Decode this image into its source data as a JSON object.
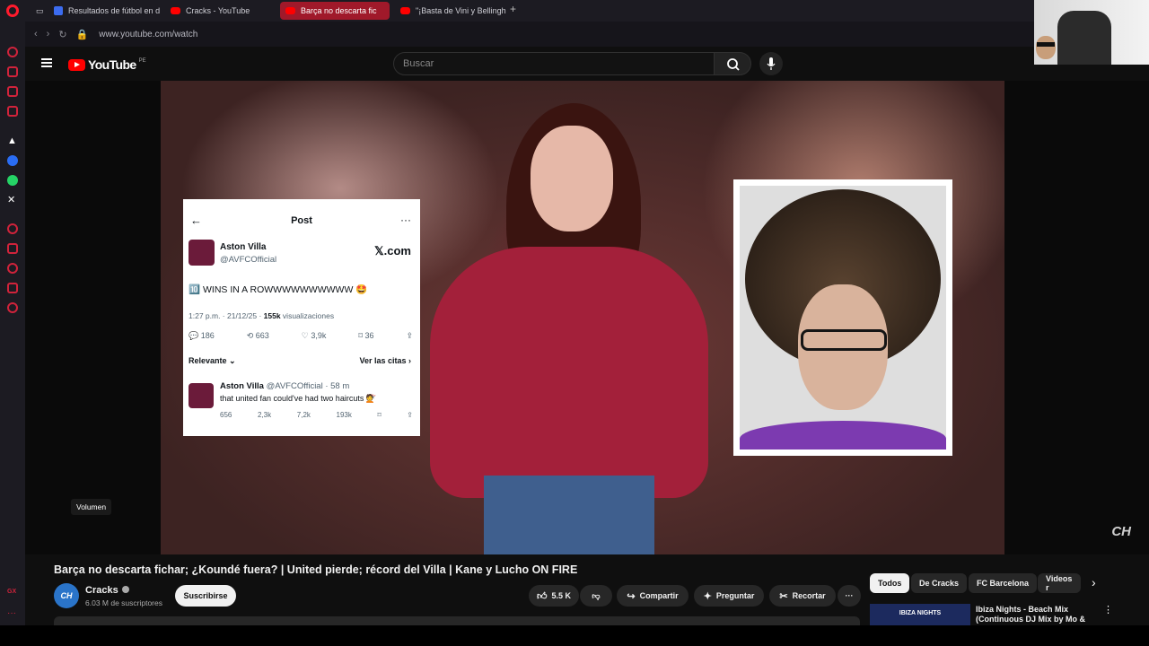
{
  "browser": {
    "tabs": [
      {
        "label": "Resultados de fútbol en d",
        "icon": "blue-square-icon"
      },
      {
        "label": "Cracks - YouTube",
        "icon": "youtube-icon"
      },
      {
        "label": "Barça no descarta fic",
        "icon": "youtube-icon",
        "active": true
      },
      {
        "label": "\"¡Basta de Vini y Bellingha",
        "icon": "youtube-icon"
      }
    ],
    "new_tab": "+",
    "url": "www.youtube.com/watch"
  },
  "youtube": {
    "logo_text": "YouTube",
    "country": "PE",
    "search_placeholder": "Buscar"
  },
  "video": {
    "tweet": {
      "header": "Post",
      "name": "Aston Villa",
      "handle": "@AVFCOfficial",
      "source": "𝕏.com",
      "text": "🔟 WINS IN A ROWWWWWWWWWW 🤩",
      "meta_time": "1:27 p.m. · 21/12/25 · ",
      "meta_views": "155k",
      "meta_views_label": " visualizaciones",
      "replies": "186",
      "reposts": "663",
      "likes": "3,9k",
      "bookmarks": "36",
      "relevant": "Relevante ⌄",
      "quotes": "Ver las citas ›",
      "reply_name": "Aston Villa",
      "reply_handle": "@AVFCOfficial · 58 m",
      "reply_text": "that united fan could've had two haircuts 💇",
      "reply_replies": "656",
      "reply_reposts": "2,3k",
      "reply_likes": "7,2k",
      "reply_views": "193k"
    },
    "volume_tooltip": "Volumen",
    "watermark": "CH"
  },
  "watch": {
    "title": "Barça no descarta fichar; ¿Koundé fuera? | United pierde; récord del Villa | Kane y Lucho ON FIRE",
    "channel_name": "Cracks",
    "channel_avatar": "CH",
    "subscribers": "6.03 M de suscriptores",
    "subscribe": "Suscribirse",
    "likes": "5.5 K",
    "share": "Compartir",
    "ask": "Preguntar",
    "clip": "Recortar"
  },
  "recommendations": {
    "chips": [
      "Todos",
      "De Cracks",
      "FC Barcelona",
      "Videos r"
    ],
    "first_title": "Ibiza Nights - Beach Mix (Continuous DJ Mix by Mo &",
    "first_thumb_text": "IBIZA NIGHTS"
  }
}
